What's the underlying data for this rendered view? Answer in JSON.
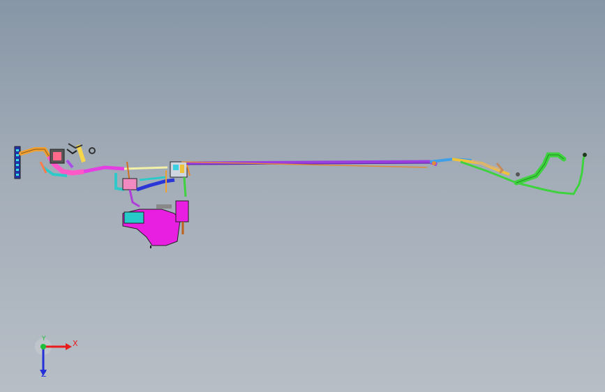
{
  "viewport": {
    "background_top": "#8796a6",
    "background_bottom": "#b7bec6"
  },
  "model": {
    "icon": "fuel-line-assembly-3d-model",
    "colors": {
      "main_line_purple": "#9a3ee0",
      "main_line_orange": "#e08a3a",
      "magenta_tank": "#e81fe0",
      "cyan_parts": "#27c9c9",
      "green_rear_line": "#3fd23f",
      "blue_hose": "#2a37d6",
      "yellow_parts": "#f0c23a"
    }
  },
  "triad": {
    "icon": "coordinate-triad-icon",
    "x_label": "X",
    "y_label": "Y",
    "z_label": "Z",
    "x_color": "#e81c1c",
    "y_color": "#1fbf3a",
    "z_color": "#2430d8"
  }
}
